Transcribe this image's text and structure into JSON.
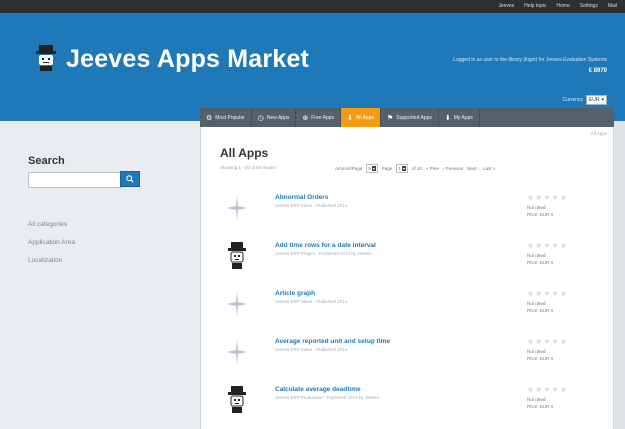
{
  "top_nav": [
    "Jeeves",
    "Help topic",
    "Home",
    "Settings",
    "Mail"
  ],
  "brand": "Jeeves Apps Market",
  "header": {
    "login_text": "Logged in as user to the library (login) for Jeeves Evaluation Systems",
    "rate": "€ 8970",
    "language_label": "Currency",
    "language_value": "EUR"
  },
  "tabs": [
    {
      "label": "Most Popular",
      "icon": "⚙"
    },
    {
      "label": "New Apps",
      "icon": "◷"
    },
    {
      "label": "Free Apps",
      "icon": "⊕"
    },
    {
      "label": "All Apps",
      "icon": "⬇"
    },
    {
      "label": "Supported Apps",
      "icon": "⚑"
    },
    {
      "label": "My Apps",
      "icon": "⬇"
    }
  ],
  "sidebar": {
    "search_title": "Search",
    "search_placeholder": "",
    "categories": [
      "All categories",
      "Application Area",
      "Localization"
    ]
  },
  "main": {
    "corner_link": "All Apps",
    "title": "All Apps",
    "subtitle": "Showing 1 - 20 of 84 results",
    "filters": {
      "amount_label": "Amount/Page",
      "amount_value": "9",
      "page_label": "Page",
      "page_value": "1",
      "page_suffix": "of 10",
      "prev": "« Prev",
      "previous_label": "‹ Previous",
      "next": "Next ›",
      "last": "Last »"
    },
    "apps": [
      {
        "name": "Abnormal Orders",
        "meta": "Jeeves ERP Sales · Published 2014",
        "rating": "Not rated",
        "date": "Price: EUR 0",
        "thumb": "star"
      },
      {
        "name": "Add time rows for a date interval",
        "meta": "Jeeves ERP Project · Published 2013 by Jeeves",
        "rating": "Not rated",
        "date": "Price: EUR 0",
        "thumb": "mascot"
      },
      {
        "name": "Article graph",
        "meta": "Jeeves ERP Sales · Published 2014",
        "rating": "Not rated",
        "date": "Price: EUR 0",
        "thumb": "star"
      },
      {
        "name": "Average reported unit and setup time",
        "meta": "Jeeves ERP Sales · Published 2014",
        "rating": "Not rated",
        "date": "Price: EUR 0",
        "thumb": "star"
      },
      {
        "name": "Calculate average deadtime",
        "meta": "Jeeves ERP Production · Published 2013 by Jeeves",
        "rating": "Not rated",
        "date": "Price: EUR 0",
        "thumb": "mascot"
      }
    ]
  }
}
